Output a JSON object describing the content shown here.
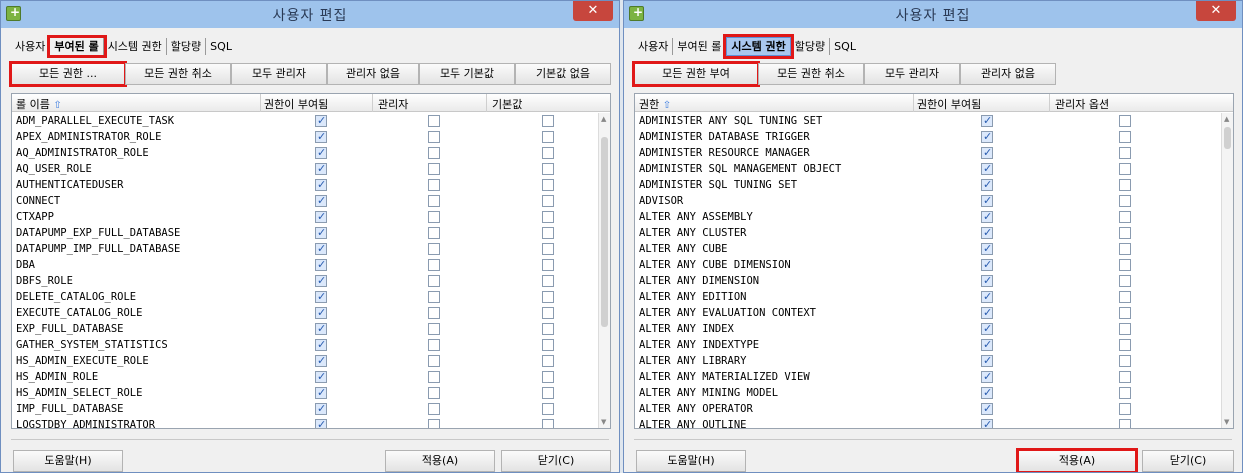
{
  "w1": {
    "title": "사용자 편집",
    "close": "✕",
    "tabs": [
      "사용자",
      "부여된 롤",
      "시스템 권한",
      "할당량",
      "SQL"
    ],
    "buttons": [
      "모든 권한 ...",
      "모든 권한 취소",
      "모두 관리자",
      "관리자 없음",
      "모두 기본값",
      "기본값 없음"
    ],
    "columns": [
      "롤 이름",
      "권한이 부여됨",
      "관리자",
      "기본값"
    ],
    "rows": [
      {
        "name": "ADM_PARALLEL_EXECUTE_TASK",
        "granted": true,
        "admin": false,
        "default": false
      },
      {
        "name": "APEX_ADMINISTRATOR_ROLE",
        "granted": true,
        "admin": false,
        "default": false
      },
      {
        "name": "AQ_ADMINISTRATOR_ROLE",
        "granted": true,
        "admin": false,
        "default": false
      },
      {
        "name": "AQ_USER_ROLE",
        "granted": true,
        "admin": false,
        "default": false
      },
      {
        "name": "AUTHENTICATEDUSER",
        "granted": true,
        "admin": false,
        "default": false
      },
      {
        "name": "CONNECT",
        "granted": true,
        "admin": false,
        "default": false
      },
      {
        "name": "CTXAPP",
        "granted": true,
        "admin": false,
        "default": false
      },
      {
        "name": "DATAPUMP_EXP_FULL_DATABASE",
        "granted": true,
        "admin": false,
        "default": false
      },
      {
        "name": "DATAPUMP_IMP_FULL_DATABASE",
        "granted": true,
        "admin": false,
        "default": false
      },
      {
        "name": "DBA",
        "granted": true,
        "admin": false,
        "default": false
      },
      {
        "name": "DBFS_ROLE",
        "granted": true,
        "admin": false,
        "default": false
      },
      {
        "name": "DELETE_CATALOG_ROLE",
        "granted": true,
        "admin": false,
        "default": false
      },
      {
        "name": "EXECUTE_CATALOG_ROLE",
        "granted": true,
        "admin": false,
        "default": false
      },
      {
        "name": "EXP_FULL_DATABASE",
        "granted": true,
        "admin": false,
        "default": false
      },
      {
        "name": "GATHER_SYSTEM_STATISTICS",
        "granted": true,
        "admin": false,
        "default": false
      },
      {
        "name": "HS_ADMIN_EXECUTE_ROLE",
        "granted": true,
        "admin": false,
        "default": false
      },
      {
        "name": "HS_ADMIN_ROLE",
        "granted": true,
        "admin": false,
        "default": false
      },
      {
        "name": "HS_ADMIN_SELECT_ROLE",
        "granted": true,
        "admin": false,
        "default": false
      },
      {
        "name": "IMP_FULL_DATABASE",
        "granted": true,
        "admin": false,
        "default": false
      },
      {
        "name": "LOGSTDBY_ADMINISTRATOR",
        "granted": true,
        "admin": false,
        "default": false
      }
    ],
    "help": "도움말(H)",
    "apply": "적용(A)",
    "close_btn": "닫기(C)"
  },
  "w2": {
    "title": "사용자 편집",
    "close": "✕",
    "tabs": [
      "사용자",
      "부여된 롤",
      "시스템 권한",
      "할당량",
      "SQL"
    ],
    "buttons": [
      "모든 권한 부여",
      "모든 권한 취소",
      "모두 관리자",
      "관리자 없음"
    ],
    "columns": [
      "권한",
      "권한이 부여됨",
      "관리자 옵션"
    ],
    "rows": [
      {
        "name": "ADMINISTER ANY SQL TUNING SET",
        "granted": true,
        "admin": false
      },
      {
        "name": "ADMINISTER DATABASE TRIGGER",
        "granted": true,
        "admin": false
      },
      {
        "name": "ADMINISTER RESOURCE MANAGER",
        "granted": true,
        "admin": false
      },
      {
        "name": "ADMINISTER SQL MANAGEMENT OBJECT",
        "granted": true,
        "admin": false
      },
      {
        "name": "ADMINISTER SQL TUNING SET",
        "granted": true,
        "admin": false
      },
      {
        "name": "ADVISOR",
        "granted": true,
        "admin": false
      },
      {
        "name": "ALTER ANY ASSEMBLY",
        "granted": true,
        "admin": false
      },
      {
        "name": "ALTER ANY CLUSTER",
        "granted": true,
        "admin": false
      },
      {
        "name": "ALTER ANY CUBE",
        "granted": true,
        "admin": false
      },
      {
        "name": "ALTER ANY CUBE DIMENSION",
        "granted": true,
        "admin": false
      },
      {
        "name": "ALTER ANY DIMENSION",
        "granted": true,
        "admin": false
      },
      {
        "name": "ALTER ANY EDITION",
        "granted": true,
        "admin": false
      },
      {
        "name": "ALTER ANY EVALUATION CONTEXT",
        "granted": true,
        "admin": false
      },
      {
        "name": "ALTER ANY INDEX",
        "granted": true,
        "admin": false
      },
      {
        "name": "ALTER ANY INDEXTYPE",
        "granted": true,
        "admin": false
      },
      {
        "name": "ALTER ANY LIBRARY",
        "granted": true,
        "admin": false
      },
      {
        "name": "ALTER ANY MATERIALIZED VIEW",
        "granted": true,
        "admin": false
      },
      {
        "name": "ALTER ANY MINING MODEL",
        "granted": true,
        "admin": false
      },
      {
        "name": "ALTER ANY OPERATOR",
        "granted": true,
        "admin": false
      },
      {
        "name": "ALTER ANY OUTLINE",
        "granted": true,
        "admin": false
      }
    ],
    "help": "도움말(H)",
    "apply": "적용(A)",
    "close_btn": "닫기(C)"
  }
}
